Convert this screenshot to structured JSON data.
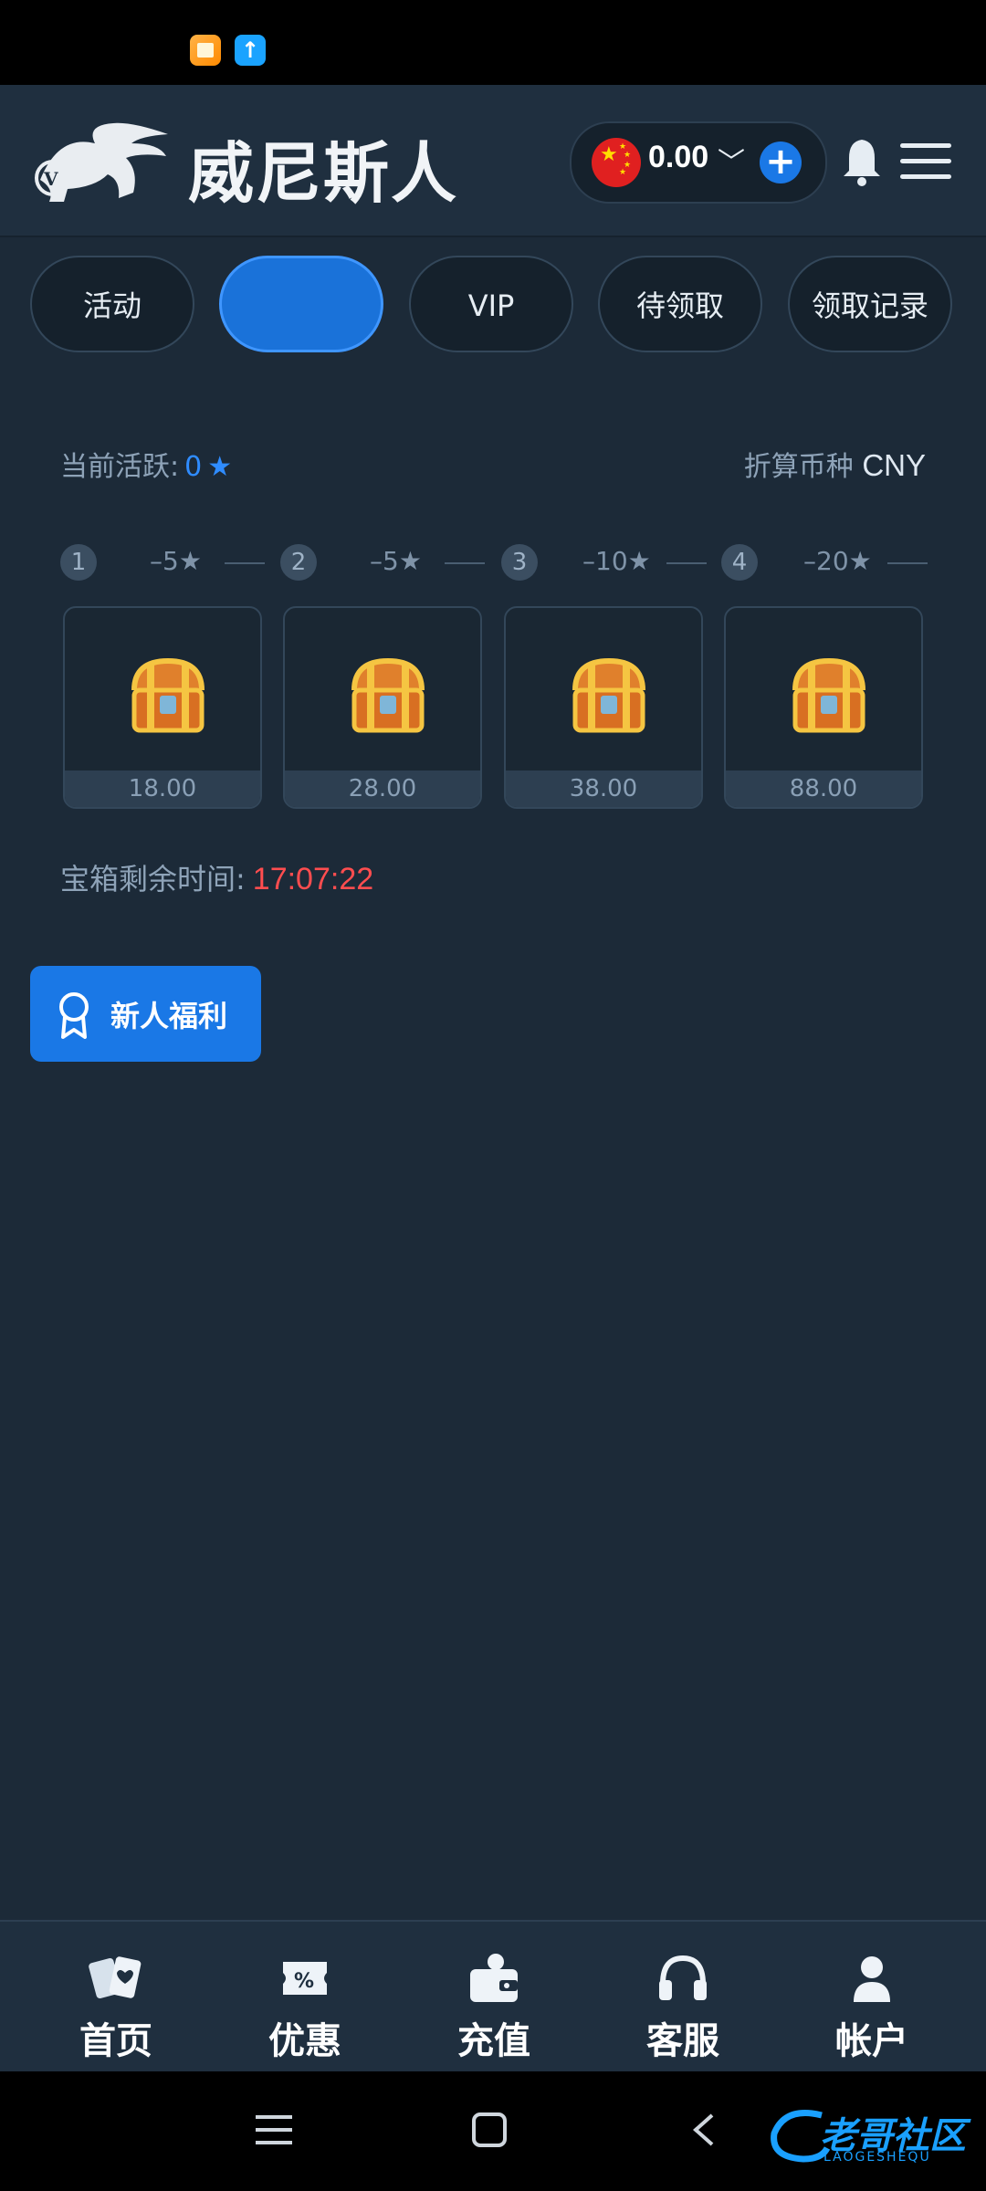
{
  "header": {
    "brand": "威尼斯人",
    "balance": "0.00"
  },
  "tabs": [
    {
      "label": "活动"
    },
    {
      "label": ""
    },
    {
      "label": "VIP"
    },
    {
      "label": "待领取"
    },
    {
      "label": "领取记录"
    }
  ],
  "activity": {
    "label": "当前活跃:",
    "value": "0",
    "currency_label": "折算币种",
    "currency": "CNY"
  },
  "steps": [
    {
      "num": "1",
      "cost": "–5"
    },
    {
      "num": "2",
      "cost": "–5"
    },
    {
      "num": "3",
      "cost": "–10"
    },
    {
      "num": "4",
      "cost": "–20"
    }
  ],
  "chests": [
    {
      "amount": "18.00"
    },
    {
      "amount": "28.00"
    },
    {
      "amount": "38.00"
    },
    {
      "amount": "88.00"
    }
  ],
  "timer": {
    "label": "宝箱剩余时间:",
    "value": "17:07:22"
  },
  "newbie_button": "新人福利",
  "bottom_nav": [
    {
      "label": "首页",
      "icon": "cards-icon"
    },
    {
      "label": "优惠",
      "icon": "coupon-icon"
    },
    {
      "label": "充值",
      "icon": "wallet-icon"
    },
    {
      "label": "客服",
      "icon": "headset-icon"
    },
    {
      "label": "帐户",
      "icon": "user-icon"
    }
  ],
  "watermark": {
    "text": "老哥社区",
    "sub": "LAOGESHEQU"
  },
  "colors": {
    "background": "#1c2a38",
    "accent": "#1a78e6",
    "timer": "#ff4d4f"
  }
}
